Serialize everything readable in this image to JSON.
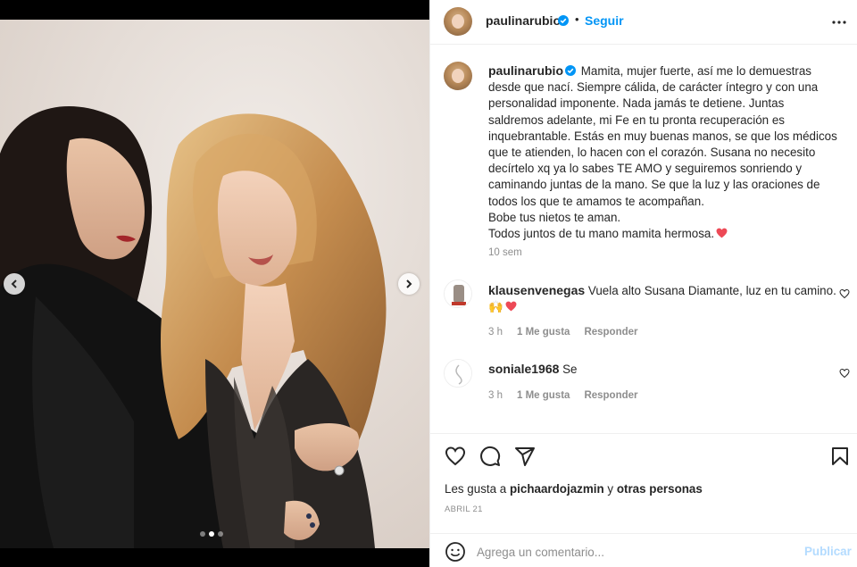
{
  "post": {
    "username": "paulinarubio",
    "follow_label": "Seguir",
    "separator": "•",
    "caption_lines": [
      "Mamita, mujer fuerte, así me lo demuestras",
      "desde que nací. Siempre cálida, de carácter íntegro y con una",
      "personalidad imponente. Nada jamás te detiene. Juntas",
      "saldremos adelante, mi Fe en tu pronta recuperación es",
      "inquebrantable. Estás en muy buenas manos, se que los médicos",
      "que te atienden, lo hacen con el corazón. Susana no necesito",
      "decírtelo xq ya lo sabes TE AMO y seguiremos sonriendo y",
      "caminando juntas de la mano. Se que la luz y las oraciones de",
      "todos los que te amamos te acompañan.",
      "Bobe tus nietos te aman.",
      "Todos juntos de tu mano mamita hermosa."
    ],
    "caption_time": "10 sem",
    "likes_prefix": "Les gusta a",
    "likes_user": "pichaardojazmin",
    "likes_joiner": "y",
    "likes_others": "otras personas",
    "date": "ABRIL 21"
  },
  "comments": [
    {
      "username": "klausenvenegas",
      "text": "Vuela alto Susana Diamante, luz en tu camino.",
      "emoji_line": "🙌",
      "time": "3 h",
      "likes": "1 Me gusta",
      "reply": "Responder"
    },
    {
      "username": "soniale1968",
      "text": "Se",
      "time": "3 h",
      "likes": "1 Me gusta",
      "reply": "Responder"
    }
  ],
  "comment_box": {
    "placeholder": "Agrega un comentario...",
    "publish_label": "Publicar"
  },
  "carousel": {
    "slides": 3,
    "active_index": 1
  },
  "colors": {
    "accent": "#0095f6",
    "heart": "#ed4956",
    "publish_disabled": "#b3dbff",
    "muted": "#8e8e8e"
  },
  "icons": [
    "verified-icon",
    "more-options-icon",
    "heart-icon",
    "comment-icon",
    "share-icon",
    "save-icon",
    "emoji-icon",
    "chevron-left-icon",
    "chevron-right-icon"
  ]
}
